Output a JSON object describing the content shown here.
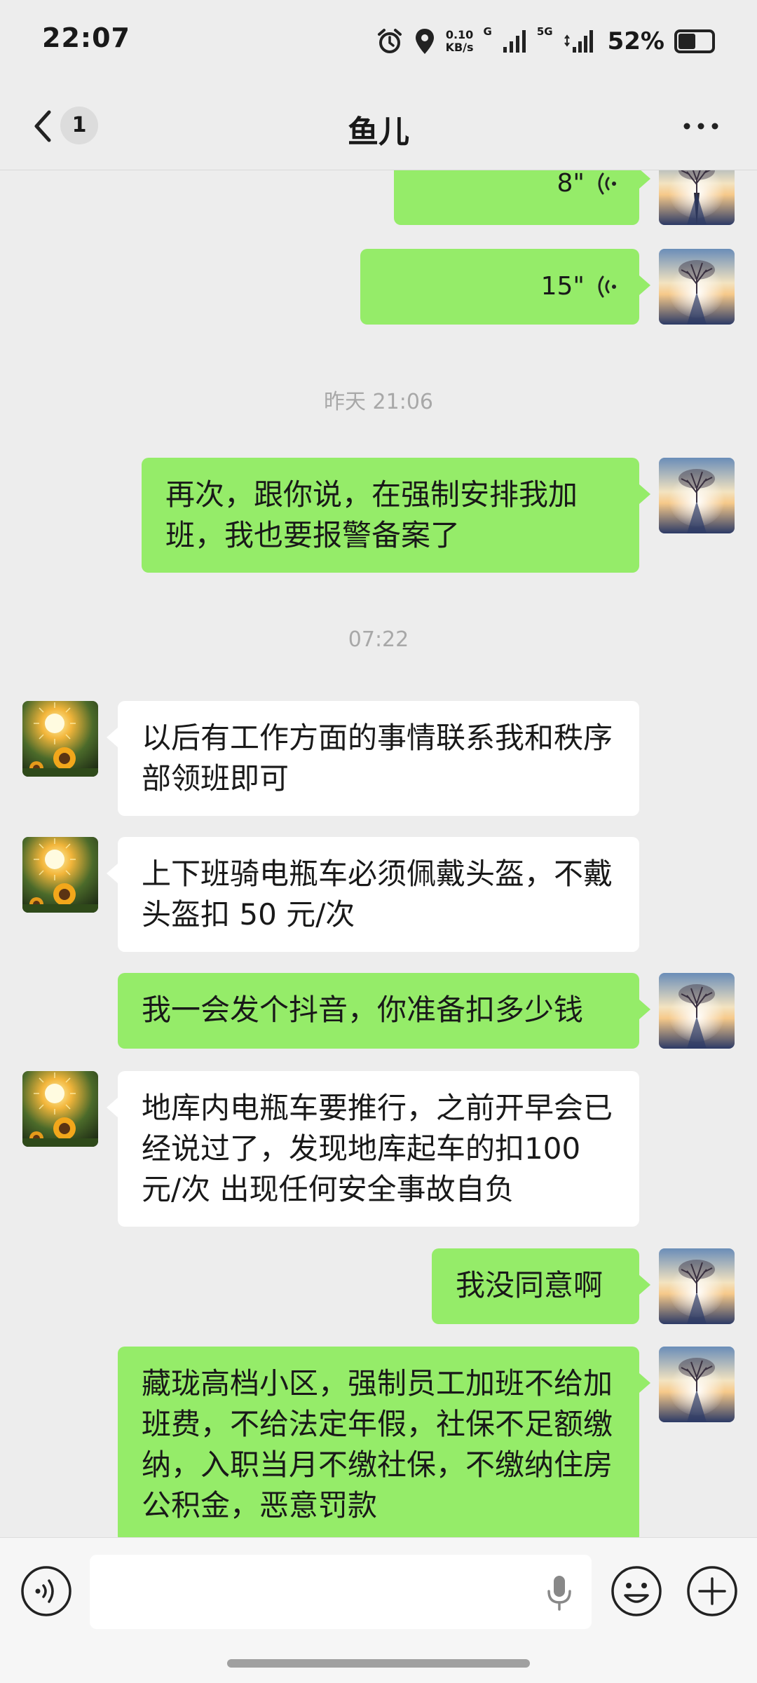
{
  "status_bar": {
    "time": "22:07",
    "net_speed_value": "0.10",
    "net_speed_unit": "KB/s",
    "sim1_label": "G",
    "sim2_label": "5G",
    "battery": "52%",
    "icons": [
      "alarm-icon",
      "location-icon",
      "signal-icon",
      "battery-icon"
    ]
  },
  "header": {
    "unread_count": "1",
    "title": "鱼儿",
    "icons": [
      "back-icon",
      "more-icon"
    ]
  },
  "messages": [
    {
      "side": "me",
      "type": "voice",
      "duration": "8\""
    },
    {
      "side": "me",
      "type": "voice",
      "duration": "15\""
    },
    {
      "type": "timestamp",
      "text": "昨天 21:06"
    },
    {
      "side": "me",
      "type": "text",
      "text": "再次，跟你说，在强制安排我加班，我也要报警备案了"
    },
    {
      "type": "timestamp",
      "text": "07:22"
    },
    {
      "side": "other",
      "type": "text",
      "text": "以后有工作方面的事情联系我和秩序部领班即可"
    },
    {
      "side": "other",
      "type": "text",
      "text": "上下班骑电瓶车必须佩戴头盔，不戴头盔扣 50 元/次"
    },
    {
      "side": "me",
      "type": "text",
      "text": "我一会发个抖音，你准备扣多少钱"
    },
    {
      "side": "other",
      "type": "text",
      "text": "地库内电瓶车要推行，之前开早会已经说过了，发现地库起车的扣100 元/次 出现任何安全事故自负"
    },
    {
      "side": "me",
      "type": "text",
      "text": "我没同意啊"
    },
    {
      "side": "me",
      "type": "text",
      "text": "藏珑高档小区，强制员工加班不给加班费，不给法定年假，社保不足额缴纳，入职当月不缴社保，不缴纳住房公积金，恶意罚款"
    }
  ],
  "input_bar": {
    "icons": [
      "voice-input-icon",
      "microphone-icon",
      "emoji-icon",
      "plus-icon"
    ]
  },
  "colors": {
    "background": "#ededed",
    "my_bubble": "#95ec69",
    "other_bubble": "#ffffff"
  }
}
